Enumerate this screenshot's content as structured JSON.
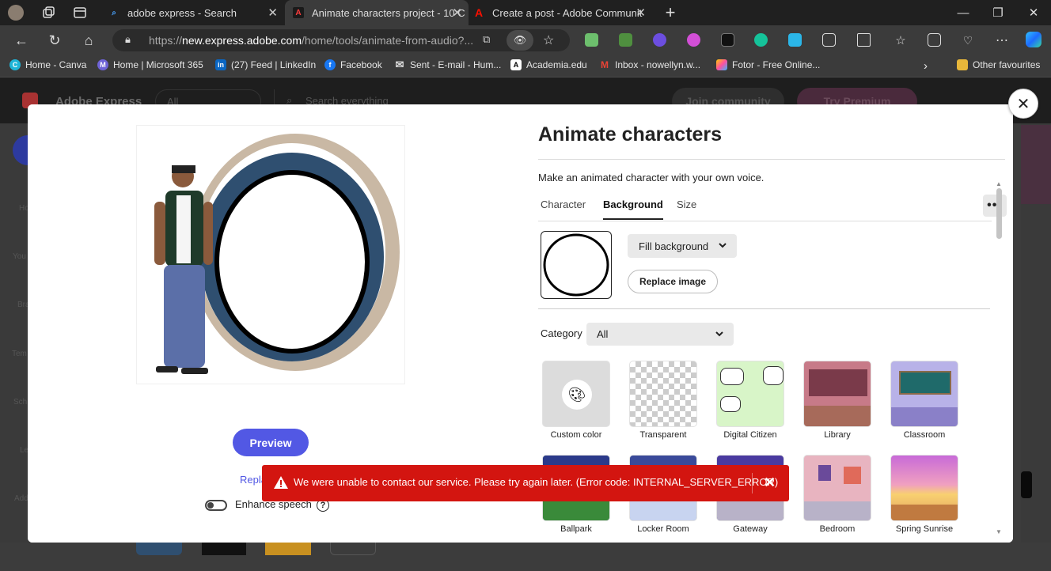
{
  "browser": {
    "tabs": [
      {
        "title": "adobe express - Search",
        "active": false
      },
      {
        "title": "Animate characters project - 10 C",
        "active": true
      },
      {
        "title": "Create a post - Adobe Communit",
        "active": false
      }
    ],
    "new_tab": "+",
    "address": {
      "prefix": "https://",
      "host": "new.express.adobe.com",
      "path": "/home/tools/animate-from-audio?..."
    },
    "favorites": [
      "Home - Canva",
      "Home | Microsoft 365",
      "(27) Feed | LinkedIn",
      "Facebook",
      "Sent - E-mail - Hum...",
      "Academia.edu",
      "Inbox - nowellyn.w...",
      "Fotor - Free Online..."
    ],
    "other_favorites": "Other favourites"
  },
  "background_app": {
    "brand": "Adobe Express",
    "search_scope": "All",
    "search_placeholder": "Search everything",
    "join": "Join community",
    "premium": "Try Premium",
    "sidebar_fragments": [
      "Ho",
      "You",
      "Bra",
      "Tem",
      "Sch",
      "Le",
      "Add"
    ]
  },
  "modal": {
    "title": "Animate characters",
    "subtitle": "Make an animated character with your own voice.",
    "tabs": [
      "Character",
      "Background",
      "Size"
    ],
    "selected_tab": "Background",
    "more": "•••",
    "fill_dropdown": "Fill background",
    "replace_image": "Replace image",
    "category_label": "Category",
    "category_value": "All",
    "backgrounds": [
      {
        "label": "Custom color"
      },
      {
        "label": "Transparent"
      },
      {
        "label": "Digital Citizen"
      },
      {
        "label": "Library"
      },
      {
        "label": "Classroom"
      },
      {
        "label": "Ballpark"
      },
      {
        "label": "Locker Room"
      },
      {
        "label": "Gateway"
      },
      {
        "label": "Bedroom"
      },
      {
        "label": "Spring Sunrise"
      }
    ],
    "preview_button": "Preview",
    "replace_link": "Repla",
    "enhance_speech": "Enhance speech",
    "help": "?",
    "close": "✕"
  },
  "error": {
    "message": "We were unable to contact our service. Please try again later. (Error code: INTERNAL_SERVER_ERROR)",
    "close": "✕"
  },
  "colors": {
    "accent": "#5258e4",
    "error": "#d31510"
  }
}
